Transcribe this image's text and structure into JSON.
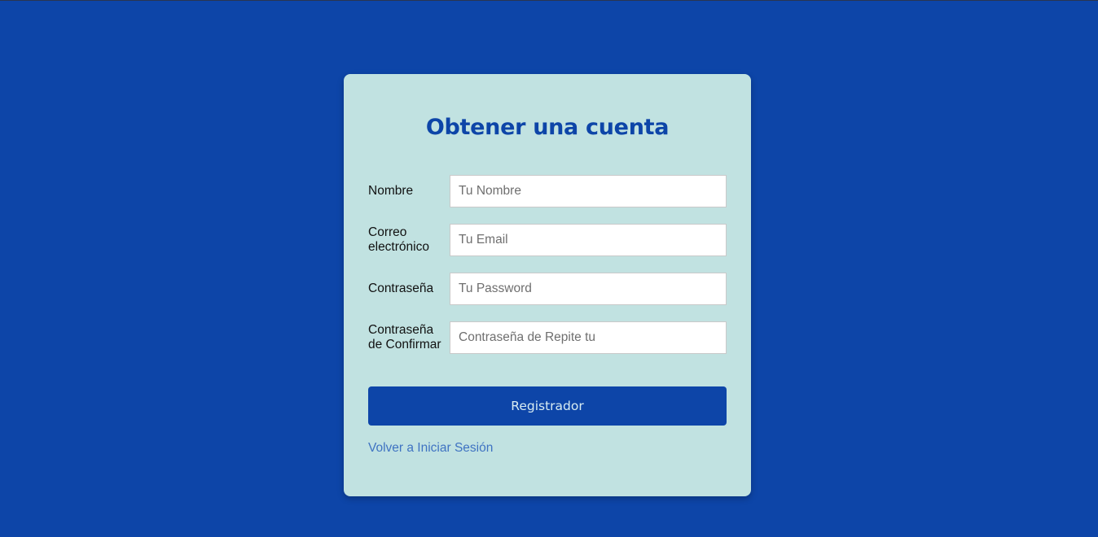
{
  "form": {
    "title": "Obtener una cuenta",
    "fields": [
      {
        "label": "Nombre",
        "placeholder": "Tu Nombre",
        "value": ""
      },
      {
        "label": "Correo electrónico",
        "placeholder": "Tu Email",
        "value": ""
      },
      {
        "label": "Contraseña",
        "placeholder": "Tu Password",
        "value": ""
      },
      {
        "label": "Contraseña de Confirmar",
        "placeholder": "Contraseña de Repite tu",
        "value": ""
      }
    ],
    "submit_label": "Registrador",
    "back_link": "Volver a Iniciar Sesión"
  },
  "colors": {
    "background": "#0d45a8",
    "card": "#c1e2e1",
    "accent": "#0d45a8",
    "link": "#3f73c2"
  }
}
